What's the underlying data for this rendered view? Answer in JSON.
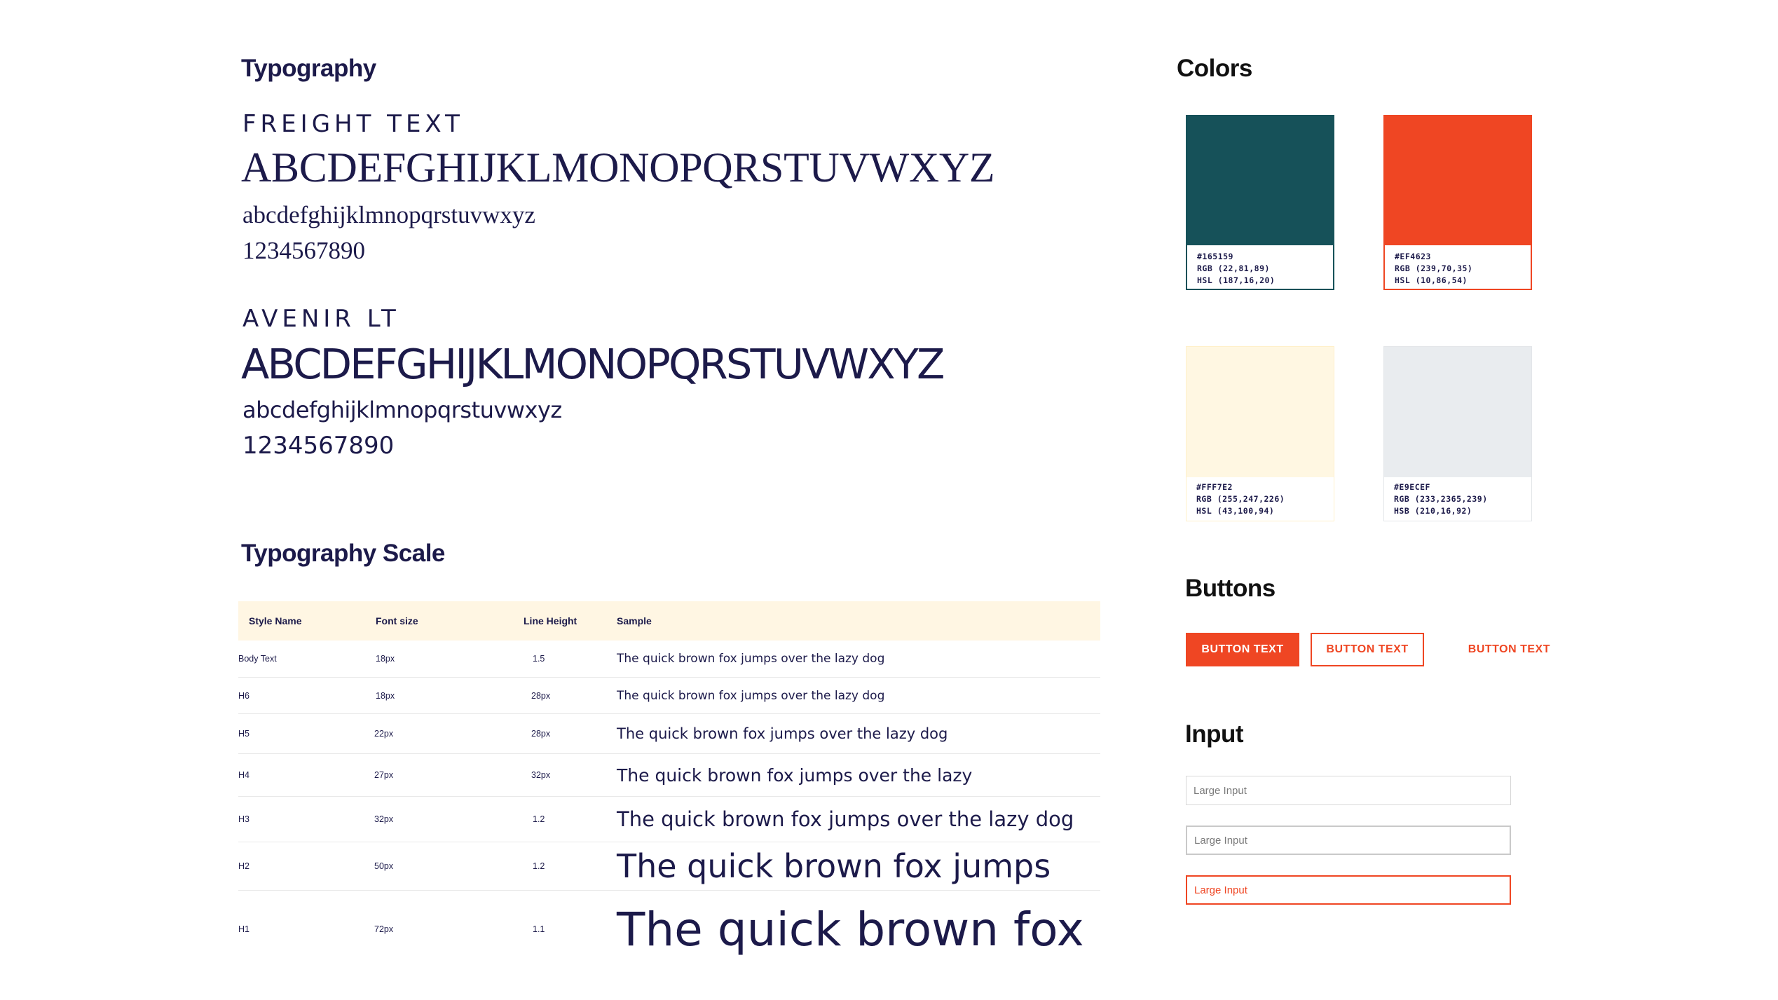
{
  "typography": {
    "title": "Typography",
    "fonts": [
      {
        "name": "FREIGHT TEXT",
        "uppercase": "ABCDEFGHIJKLMONOPQRSTUVWXYZ",
        "lowercase": "abcdefghijklmnopqrstuvwxyz",
        "numbers": "1234567890"
      },
      {
        "name": "AVENIR LT",
        "uppercase": "ABCDEFGHIJKLMONOPQRSTUVWXYZ",
        "lowercase": "abcdefghijklmnopqrstuvwxyz",
        "numbers": "1234567890"
      }
    ]
  },
  "scale": {
    "title": "Typography Scale",
    "headers": [
      "Style Name",
      "Font size",
      "Line Height",
      "Sample"
    ],
    "rows": [
      {
        "style": "Body Text",
        "size": "18px",
        "line_height": "1.5",
        "sample": "The quick brown fox jumps over the lazy dog"
      },
      {
        "style": "H6",
        "size": "18px",
        "line_height": "28px",
        "sample": "The quick brown fox jumps over the lazy dog"
      },
      {
        "style": "H5",
        "size": "22px",
        "line_height": "28px",
        "sample": "The quick brown fox jumps over the lazy dog"
      },
      {
        "style": "H4",
        "size": "27px",
        "line_height": "32px",
        "sample": "The quick brown fox jumps over the lazy"
      },
      {
        "style": "H3",
        "size": "32px",
        "line_height": "1.2",
        "sample": "The quick brown fox jumps over the lazy dog"
      },
      {
        "style": "H2",
        "size": "50px",
        "line_height": "1.2",
        "sample": "The quick brown fox jumps"
      },
      {
        "style": "H1",
        "size": "72px",
        "line_height": "1.1",
        "sample": "The quick brown fox"
      }
    ]
  },
  "colors": {
    "title": "Colors",
    "swatches": [
      {
        "hex": "#165159",
        "rgb": "RGB (22,81,89)",
        "third": "HSL (187,16,20)",
        "hex_label": "#165159"
      },
      {
        "hex": "#EF4623",
        "rgb": "RGB (239,70,35)",
        "third": "HSL (10,86,54)",
        "hex_label": "#EF4623"
      },
      {
        "hex": "#FFF7E2",
        "rgb": "RGB (255,247,226)",
        "third": "HSL (43,100,94)",
        "hex_label": "#FFF7E2"
      },
      {
        "hex": "#E9ECEF",
        "rgb": "RGB (233,2365,239)",
        "third": "HSB (210,16,92)",
        "hex_label": "#E9ECEF"
      }
    ]
  },
  "buttons": {
    "title": "Buttons",
    "primary": "BUTTON TEXT",
    "outline": "BUTTON TEXT",
    "text": "BUTTON TEXT",
    "accent": "#ef4623"
  },
  "input": {
    "title": "Input",
    "fields": [
      {
        "placeholder": "Large Input",
        "state": "default"
      },
      {
        "placeholder": "Large Input",
        "state": "focused"
      },
      {
        "placeholder": "Large Input",
        "state": "error"
      }
    ]
  }
}
